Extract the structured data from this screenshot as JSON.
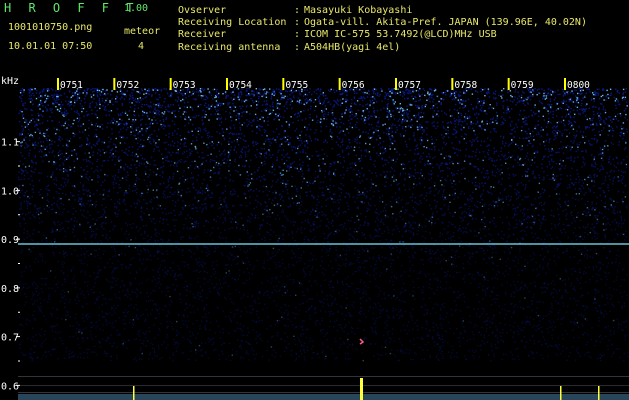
{
  "header": {
    "app_name": "H R O F F T",
    "version": "1.00",
    "filename": "1001010750.png",
    "timestamp": "10.01.01 07:50",
    "meteor_label": "meteor",
    "meteor_count": "4"
  },
  "info": [
    {
      "label": "Ovserver",
      "value": "Masayuki Kobayashi"
    },
    {
      "label": "Receiving Location",
      "value": "Ogata-vill. Akita-Pref. JAPAN (139.96E, 40.02N)"
    },
    {
      "label": "Receiver",
      "value": "ICOM IC-575 53.7492(@LCD)MHz USB"
    },
    {
      "label": "Receiving antenna",
      "value": "A504HB(yagi 4el)"
    }
  ],
  "separator": ":",
  "spectrogram": {
    "y_unit": "kHz",
    "y_ticks": [
      "1.1",
      "1.0",
      "0.9",
      "0.8",
      "0.7",
      "0.6"
    ],
    "y_range": [
      0.57,
      1.21
    ],
    "time_ticks": [
      "0751",
      "0752",
      "0753",
      "0754",
      "0755",
      "0756",
      "0757",
      "0758",
      "0759",
      "0800"
    ],
    "carrier_khz": 0.89,
    "colors": {
      "background": "#000000",
      "noise_dark": "#0a1a8a",
      "noise_bright": "#6fc8ff",
      "carrier": "#7fe8ff",
      "meteor_trace": "#ff5a8a",
      "spike": "#ffff3a",
      "tick": "#ffff00",
      "header_text": "#e8e86a",
      "title_text": "#5ee86a"
    }
  }
}
